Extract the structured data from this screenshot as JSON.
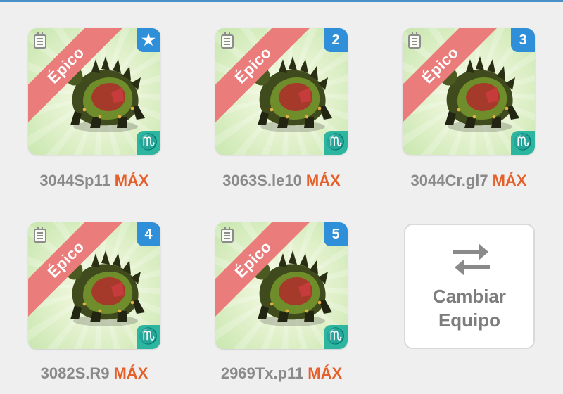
{
  "cards": [
    {
      "rarity": "Épico",
      "badge": "★",
      "element": "♏",
      "name": "3044Sp11",
      "level": "MÁX"
    },
    {
      "rarity": "Épico",
      "badge": "2",
      "element": "♏",
      "name": "3063S.le10",
      "level": "MÁX"
    },
    {
      "rarity": "Épico",
      "badge": "3",
      "element": "♏",
      "name": "3044Cr.gl7",
      "level": "MÁX"
    },
    {
      "rarity": "Épico",
      "badge": "4",
      "element": "♏",
      "name": "3082S.R9",
      "level": "MÁX"
    },
    {
      "rarity": "Épico",
      "badge": "5",
      "element": "♏",
      "name": "2969Tx.p11",
      "level": "MÁX"
    }
  ],
  "swap": {
    "line1": "Cambiar",
    "line2": "Equipo",
    "icon": "swap-arrows-icon"
  },
  "colors": {
    "rarity_ribbon": "#ea7c7c",
    "badge": "#2f8fd8",
    "element": "#2db5a0",
    "max_text": "#e5602a"
  }
}
